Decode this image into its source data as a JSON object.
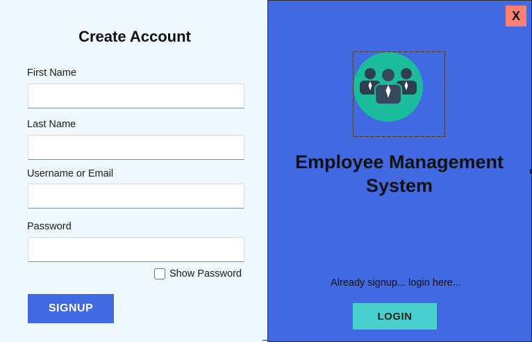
{
  "signup_form": {
    "title": "Create Account",
    "fields": [
      {
        "label": "First Name",
        "value": "",
        "placeholder": ""
      },
      {
        "label": "Last Name",
        "value": "",
        "placeholder": ""
      },
      {
        "label": "Username or Email",
        "value": "",
        "placeholder": ""
      },
      {
        "label": "Password",
        "value": "",
        "placeholder": ""
      }
    ],
    "show_password_label": "Show Password",
    "show_password_checked": false,
    "signup_label": "SIGNUP"
  },
  "side_panel": {
    "close_label": "X",
    "logo_icon": "team-icon",
    "app_title_line1": "Employee Management",
    "app_title_line2": "System",
    "login_prompt": "Already signup... login here...",
    "login_label": "LOGIN"
  },
  "colors": {
    "left_bg": "#f0f8ff",
    "right_bg": "#4169e1",
    "signup_button": "#4169e1",
    "login_button": "#48d1cc",
    "close_button": "#ff7f72",
    "logo_circle": "#1abc9c"
  }
}
